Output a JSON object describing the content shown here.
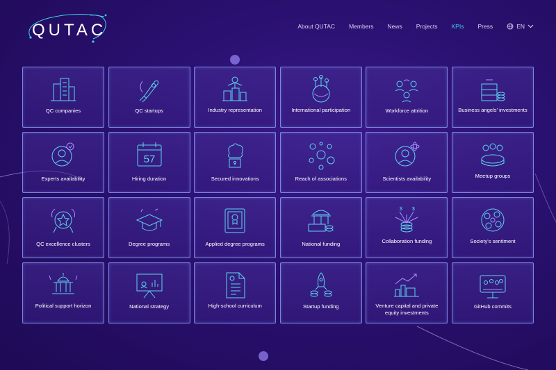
{
  "header": {
    "logo_text": "QUTAC",
    "nav": [
      {
        "label": "About QUTAC",
        "active": false
      },
      {
        "label": "Members",
        "active": false
      },
      {
        "label": "News",
        "active": false
      },
      {
        "label": "Projects",
        "active": false
      },
      {
        "label": "KPIs",
        "active": true
      },
      {
        "label": "Press",
        "active": false
      }
    ],
    "language": {
      "label": "EN",
      "icon": "globe-icon"
    }
  },
  "colors": {
    "accent": "#3ed2e6",
    "background": "#2a1070",
    "card_border": "#96aaff"
  },
  "cards": [
    {
      "label": "QC companies",
      "icon": "buildings-icon"
    },
    {
      "label": "QC startups",
      "icon": "rocket-icon"
    },
    {
      "label": "Industry representation",
      "icon": "factory-icon"
    },
    {
      "label": "International participation",
      "icon": "globe-pins-icon"
    },
    {
      "label": "Workforce attrition",
      "icon": "people-cycle-icon"
    },
    {
      "label": "Business angels' investments",
      "icon": "money-stack-icon"
    },
    {
      "label": "Experts availability",
      "icon": "expert-icon"
    },
    {
      "label": "Hiring duration",
      "icon": "calendar-icon",
      "calendar_number": "57"
    },
    {
      "label": "Secured innovations",
      "icon": "brain-lock-icon"
    },
    {
      "label": "Reach of associations",
      "icon": "network-icon"
    },
    {
      "label": "Scientists availability",
      "icon": "scientist-icon"
    },
    {
      "label": "Meetup groups",
      "icon": "meetup-icon"
    },
    {
      "label": "QC excellence clusters",
      "icon": "star-badge-icon"
    },
    {
      "label": "Degree programs",
      "icon": "graduation-cap-icon"
    },
    {
      "label": "Applied degree programs",
      "icon": "certificate-icon"
    },
    {
      "label": "National funding",
      "icon": "government-coins-icon"
    },
    {
      "label": "Collaboration funding",
      "icon": "dollar-fountain-icon"
    },
    {
      "label": "Society's sentiment",
      "icon": "emotions-icon"
    },
    {
      "label": "Political support horizon",
      "icon": "capitol-icon"
    },
    {
      "label": "National strategy",
      "icon": "presentation-icon"
    },
    {
      "label": "High-school curriculum",
      "icon": "document-icon"
    },
    {
      "label": "Startup funding",
      "icon": "rocket-coins-icon"
    },
    {
      "label": "Venture capital and private equity investments",
      "icon": "vc-chart-icon"
    },
    {
      "label": "GitHub commits",
      "icon": "github-board-icon"
    }
  ]
}
